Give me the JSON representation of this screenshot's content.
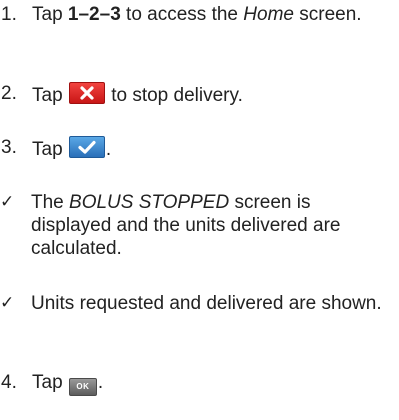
{
  "steps": [
    {
      "number": "1.",
      "text_before": "Tap ",
      "bold": "1–2–3",
      "text_middle": " to access the ",
      "italic": "Home",
      "text_after": " screen."
    },
    {
      "number": "2.",
      "text_before": "Tap ",
      "icon": "stop-delivery-x-icon",
      "text_after": " to stop delivery."
    },
    {
      "number": "3.",
      "text_before": "Tap ",
      "icon": "confirm-check-icon",
      "text_after": "."
    },
    {
      "marker": "✓",
      "text_before": "The ",
      "italic": "BOLUS STOPPED",
      "text_after": " screen is displayed and the units delivered are calculated."
    },
    {
      "marker": "✓",
      "text": "Units requested and delivered are shown."
    },
    {
      "number": "4.",
      "text_before": "Tap ",
      "icon_label": "OK",
      "text_after": "."
    }
  ],
  "colors": {
    "text": "#222222",
    "stop_button": "#d42020",
    "confirm_button": "#3a86d0",
    "ok_button": "#6e6e6e"
  }
}
